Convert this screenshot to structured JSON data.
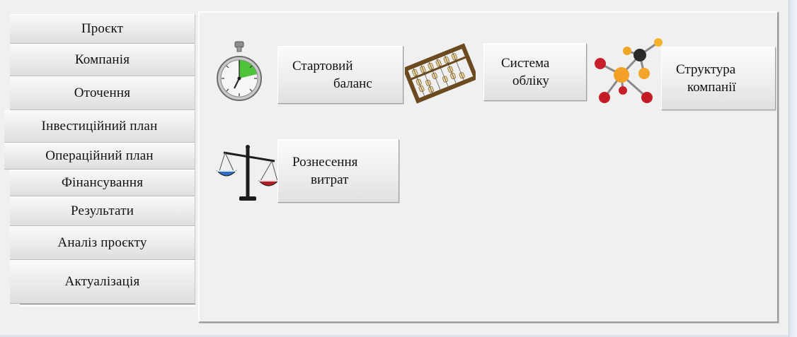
{
  "sidebar": {
    "items": [
      {
        "label": "Проєкт"
      },
      {
        "label": "Компанія"
      },
      {
        "label": "Оточення"
      },
      {
        "label": "Інвестиційний план"
      },
      {
        "label": "Операційний план"
      },
      {
        "label": "Фінансування"
      },
      {
        "label": "Результати"
      },
      {
        "label": "Аналіз проєкту"
      },
      {
        "label": "Актуалізація"
      }
    ]
  },
  "tools": [
    {
      "icon": "stopwatch-icon",
      "line1": "Стартовий",
      "line2": "баланс"
    },
    {
      "icon": "abacus-icon",
      "line1": "Система",
      "line2": "обліку"
    },
    {
      "icon": "molecule-icon",
      "line1": "Структура",
      "line2": "компанії"
    },
    {
      "icon": "scales-icon",
      "line1": "Рознесення",
      "line2": "витрат"
    }
  ],
  "colors": {
    "background": "#f0f0f0",
    "button_gradient_top": "#fbfbfb",
    "button_gradient_bottom": "#dedede",
    "panel_shadow": "#9c9c9c"
  }
}
